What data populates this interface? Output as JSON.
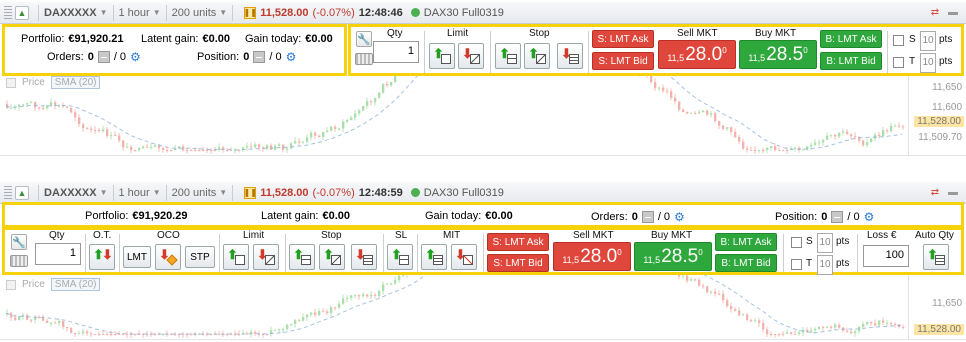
{
  "toolbar_top": {
    "ticker": "DAXXXXX",
    "timeframe": "1 hour",
    "units": "200 units",
    "price": "11,528.00",
    "change": "(-0.07%)",
    "time": "12:48:46",
    "instrument": "DAX30 Full0319"
  },
  "toolbar_bottom": {
    "ticker": "DAXXXXX",
    "timeframe": "1 hour",
    "units": "200 units",
    "price": "11,528.00",
    "change": "(-0.07%)",
    "time": "12:48:59",
    "instrument": "DAX30 Full0319"
  },
  "chart_top": {
    "legend_price": "Price",
    "legend_sma": "SMA (20)",
    "y_ticks": [
      "11,650",
      "11,600",
      "11,509.70"
    ],
    "y_current": "11,528.00"
  },
  "chart_bottom": {
    "legend_price": "Price",
    "legend_sma": "SMA (20)",
    "y_ticks": [
      "11,650"
    ],
    "y_current": "11,528.00"
  },
  "panel_compact": {
    "portfolio_label": "Portfolio:",
    "portfolio_value": "€91,920.21",
    "latent_label": "Latent gain:",
    "latent_value": "€0.00",
    "gain_today_label": "Gain today:",
    "gain_today_value": "€0.00",
    "orders_label": "Orders:",
    "orders_value": "0",
    "orders_total": "/ 0",
    "position_label": "Position:",
    "position_value": "0",
    "position_total": "/ 0",
    "qty_label": "Qty",
    "qty_value": "1",
    "limit_label": "Limit",
    "stop_label": "Stop",
    "s_lmt_ask": "S: LMT Ask",
    "s_lmt_bid": "S: LMT Bid",
    "sell_mkt_label": "Sell MKT",
    "buy_mkt_label": "Buy MKT",
    "sell_prefix": "11,5",
    "sell_price": "28.0",
    "sell_sup": "0",
    "buy_prefix": "11,5",
    "buy_price": "28.5",
    "buy_sup": "0",
    "b_lmt_ask": "B: LMT Ask",
    "b_lmt_bid": "B: LMT Bid",
    "s_label": "S",
    "t_label": "T",
    "s_pts_value": "10",
    "t_pts_value": "10",
    "pts_label": "pts"
  },
  "panel_wide": {
    "portfolio_label": "Portfolio:",
    "portfolio_value": "€91,920.29",
    "latent_label": "Latent gain:",
    "latent_value": "€0.00",
    "gain_today_label": "Gain today:",
    "gain_today_value": "€0.00",
    "orders_label": "Orders:",
    "orders_value": "0",
    "orders_total": "/ 0",
    "position_label": "Position:",
    "position_value": "0",
    "position_total": "/ 0",
    "qty_label": "Qty",
    "qty_value": "1",
    "ot_label": "O.T.",
    "oco_label": "OCO",
    "lmt_btn": "LMT",
    "stp_btn": "STP",
    "limit_label": "Limit",
    "stop_label": "Stop",
    "sl_label": "SL",
    "mit_label": "MIT",
    "s_lmt_ask": "S: LMT Ask",
    "s_lmt_bid": "S: LMT Bid",
    "sell_mkt_label": "Sell MKT",
    "buy_mkt_label": "Buy MKT",
    "sell_prefix": "11,5",
    "sell_price": "28.0",
    "sell_sup": "0",
    "buy_prefix": "11,5",
    "buy_price": "28.5",
    "buy_sup": "0",
    "b_lmt_ask": "B: LMT Ask",
    "b_lmt_bid": "B: LMT Bid",
    "s_label": "S",
    "t_label": "T",
    "s_pts_value": "10",
    "t_pts_value": "10",
    "pts_label": "pts",
    "loss_label": "Loss €",
    "loss_value": "100",
    "auto_qty_label": "Auto Qty"
  },
  "colors": {
    "highlight": "#f5d20a",
    "sell": "#e0473c",
    "buy": "#2ea83c",
    "down": "#c0392b"
  }
}
